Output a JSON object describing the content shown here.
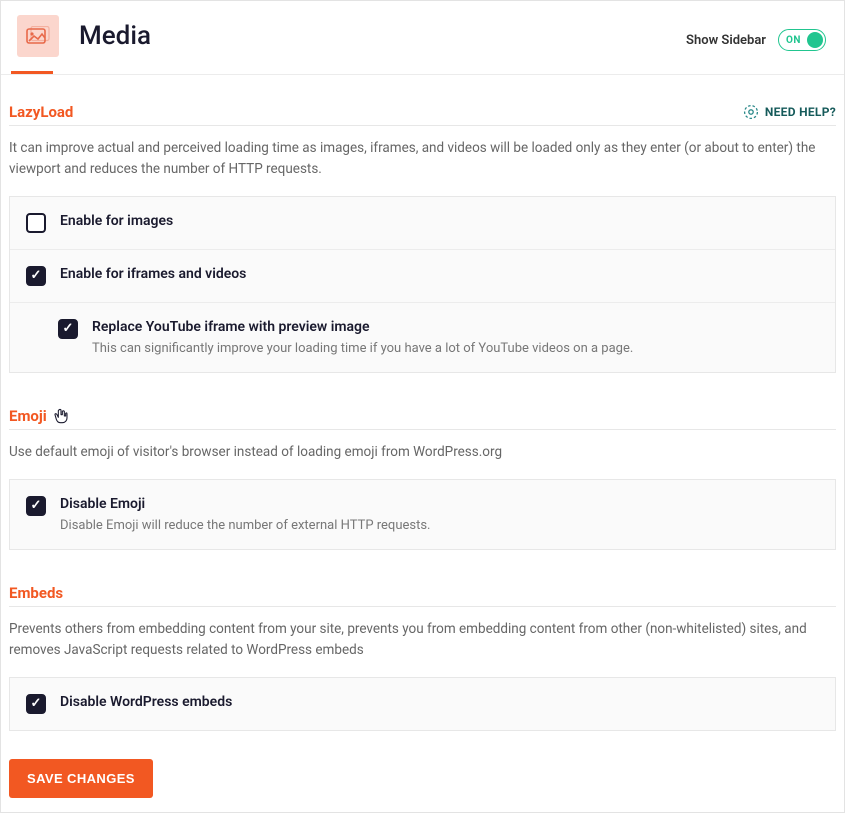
{
  "header": {
    "title": "Media",
    "show_sidebar_label": "Show Sidebar",
    "toggle_state": "ON"
  },
  "help_link": "NEED HELP?",
  "sections": {
    "lazyload": {
      "title": "LazyLoad",
      "desc": "It can improve actual and perceived loading time as images, iframes, and videos will be loaded only as they enter (or about to enter) the viewport and reduces the number of HTTP requests.",
      "opt_images": "Enable for images",
      "opt_iframes": "Enable for iframes and videos",
      "opt_youtube": "Replace YouTube iframe with preview image",
      "opt_youtube_sub": "This can significantly improve your loading time if you have a lot of YouTube videos on a page."
    },
    "emoji": {
      "title": "Emoji",
      "desc": "Use default emoji of visitor's browser instead of loading emoji from WordPress.org",
      "opt_disable": "Disable Emoji",
      "opt_disable_sub": "Disable Emoji will reduce the number of external HTTP requests."
    },
    "embeds": {
      "title": "Embeds",
      "desc": "Prevents others from embedding content from your site, prevents you from embedding content from other (non-whitelisted) sites, and removes JavaScript requests related to WordPress embeds",
      "opt_disable": "Disable WordPress embeds"
    }
  },
  "save_button": "SAVE CHANGES"
}
